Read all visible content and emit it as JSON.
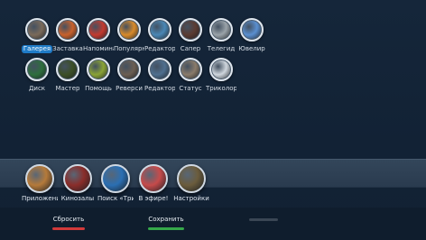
{
  "apps_row1": [
    {
      "label": "Галерея",
      "icon": "gallery-icon",
      "color": "#7a6a5a",
      "selected": true
    },
    {
      "label": "Заставка",
      "icon": "screensaver-icon",
      "color": "#c8612c",
      "selected": false
    },
    {
      "label": "Напоминание",
      "icon": "reminder-icon",
      "color": "#c33a2f",
      "selected": false
    },
    {
      "label": "Популярное",
      "icon": "popular-icon",
      "color": "#d88a2a",
      "selected": false
    },
    {
      "label": "Редактор",
      "icon": "editor-icon",
      "color": "#4a87b5",
      "selected": false
    },
    {
      "label": "Сапер",
      "icon": "minesweeper-icon",
      "color": "#5b3b32",
      "selected": false
    },
    {
      "label": "Телегид",
      "icon": "tv-guide-icon",
      "color": "#9aa3a9",
      "selected": false
    },
    {
      "label": "Ювелир",
      "icon": "jeweler-icon",
      "color": "#5a8fd0",
      "selected": false
    }
  ],
  "apps_row2": [
    {
      "label": "Диск",
      "icon": "disk-icon",
      "color": "#2e6e3d",
      "selected": false
    },
    {
      "label": "Мастер",
      "icon": "master-icon",
      "color": "#3c4f26",
      "selected": false
    },
    {
      "label": "Помощь",
      "icon": "help-icon",
      "color": "#8aa335",
      "selected": false
    },
    {
      "label": "Реверси",
      "icon": "reversi-icon",
      "color": "#6b5e52",
      "selected": false
    },
    {
      "label": "Редактор",
      "icon": "editor2-icon",
      "color": "#4f6f8f",
      "selected": false
    },
    {
      "label": "Статус",
      "icon": "status-icon",
      "color": "#8a7b6a",
      "selected": false
    },
    {
      "label": "Триколор",
      "icon": "tricolor-icon",
      "color": "#cfd6dd",
      "selected": false
    }
  ],
  "dock": [
    {
      "label": "Приложения",
      "icon": "apps-icon",
      "color": "#b57a3a"
    },
    {
      "label": "Кинозалы",
      "icon": "cinema-icon",
      "color": "#8a2d2a"
    },
    {
      "label": "Поиск «Триколор»",
      "icon": "search-icon",
      "color": "#2b6fb3"
    },
    {
      "label": "В эфире!",
      "icon": "on-air-icon",
      "color": "#c64b4b"
    },
    {
      "label": "Настройки",
      "icon": "settings-icon",
      "color": "#6b5c3c"
    }
  ],
  "footer": {
    "reset_label": "Сбросить",
    "reset_color": "#d23a3a",
    "save_label": "Сохранить",
    "save_color": "#35a84a",
    "third_color": "#3a4654"
  }
}
